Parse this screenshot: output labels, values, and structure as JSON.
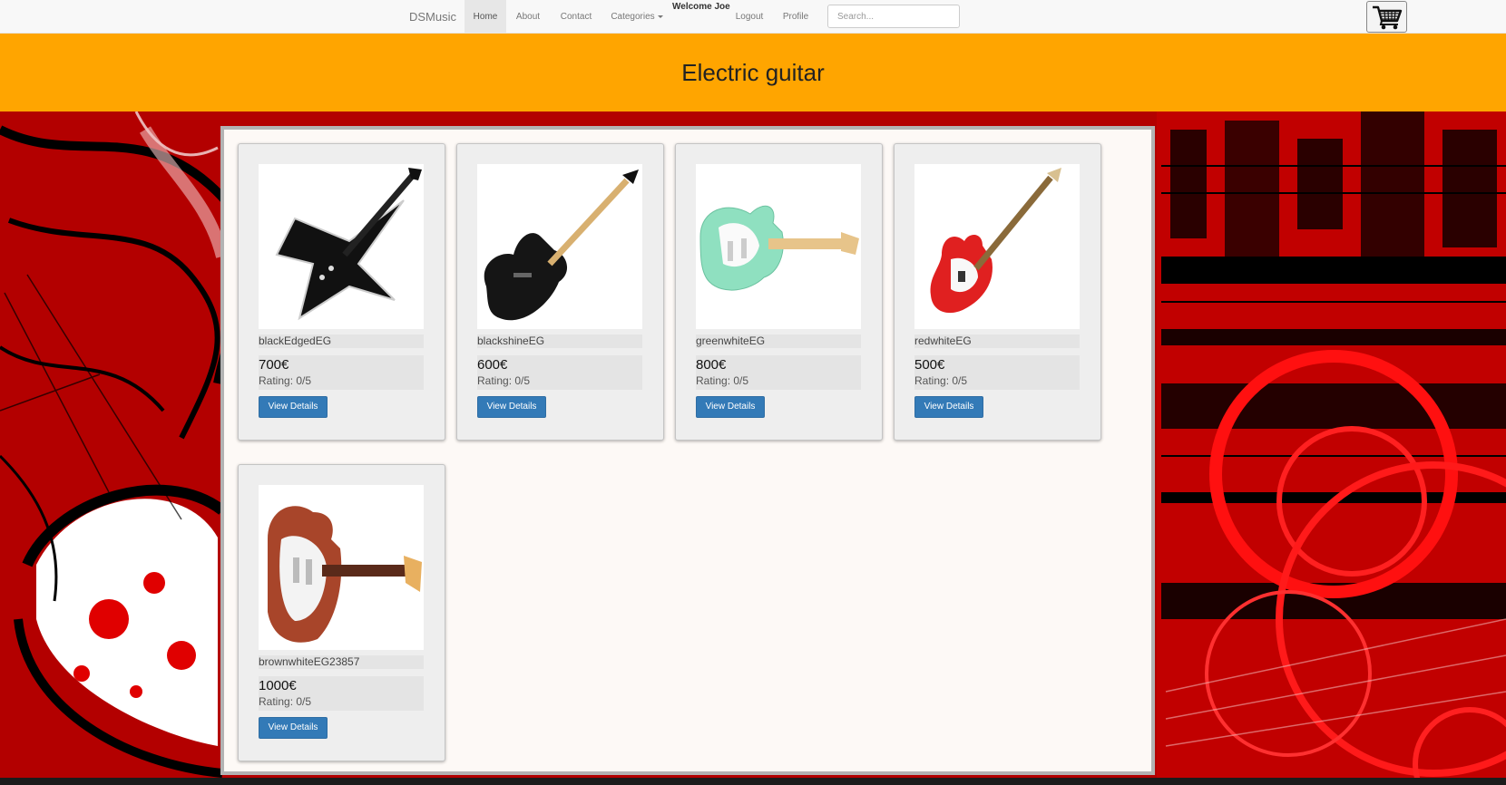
{
  "navbar": {
    "brand": "DSMusic",
    "items": [
      {
        "label": "Home"
      },
      {
        "label": "About"
      },
      {
        "label": "Contact"
      },
      {
        "label": "Categories"
      },
      {
        "label": "Logout"
      },
      {
        "label": "Profile"
      }
    ],
    "welcome": "Welcome Joe",
    "search_placeholder": "Search...",
    "cart_icon": "shopping-cart-icon",
    "active_item": "Home"
  },
  "banner": {
    "title": "Electric guitar",
    "color": "#ffa500"
  },
  "products": [
    {
      "name": "blackEdgedEG",
      "price": "700€",
      "rating": "Rating: 0/5",
      "button": "View Details"
    },
    {
      "name": "blackshineEG",
      "price": "600€",
      "rating": "Rating: 0/5",
      "button": "View Details"
    },
    {
      "name": "greenwhiteEG",
      "price": "800€",
      "rating": "Rating: 0/5",
      "button": "View Details"
    },
    {
      "name": "redwhiteEG",
      "price": "500€",
      "rating": "Rating: 0/5",
      "button": "View Details"
    },
    {
      "name": "brownwhiteEG23857",
      "price": "1000€",
      "rating": "Rating: 0/5",
      "button": "View Details"
    }
  ],
  "colors": {
    "primary_button": "#337ab7",
    "background_art": "#b80000"
  }
}
